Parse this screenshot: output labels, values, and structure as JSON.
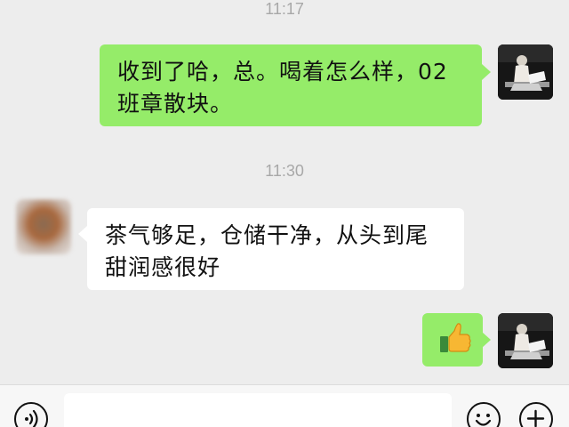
{
  "chat": {
    "timestamps": [
      "11:17",
      "11:30"
    ],
    "messages": [
      {
        "side": "right",
        "text": "收到了哈，总。喝着怎么样，02班章散块。"
      },
      {
        "side": "left",
        "text": "茶气够足，仓储干净，从头到尾甜润感很好"
      },
      {
        "side": "right",
        "emoji": "thumbs-up-icon"
      }
    ]
  },
  "input_bar": {
    "voice_icon": "voice-icon",
    "emoji_icon": "emoji-icon",
    "plus_icon": "plus-icon",
    "input_value": ""
  },
  "colors": {
    "background": "#ededed",
    "outgoing_bubble": "#95ec69",
    "incoming_bubble": "#ffffff",
    "timestamp_text": "#a8a8a8"
  }
}
